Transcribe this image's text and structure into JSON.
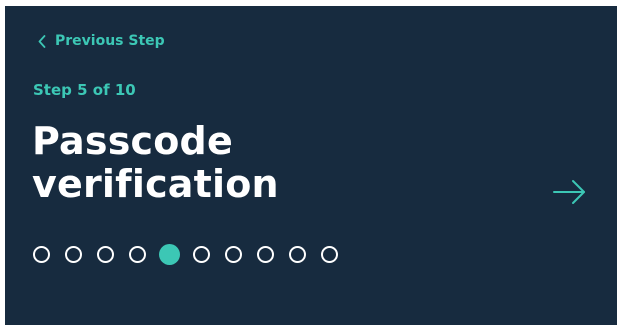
{
  "nav": {
    "previous_label": "Previous Step",
    "previous_icon": "chevron-left-icon",
    "next_icon": "arrow-right-icon"
  },
  "step": {
    "label": "Step 5 of 10",
    "current": 5,
    "total": 10
  },
  "title": {
    "line1": "Passcode",
    "line2": "verification"
  },
  "colors": {
    "background": "#172b3f",
    "accent": "#3cc7b5",
    "text": "#ffffff"
  }
}
